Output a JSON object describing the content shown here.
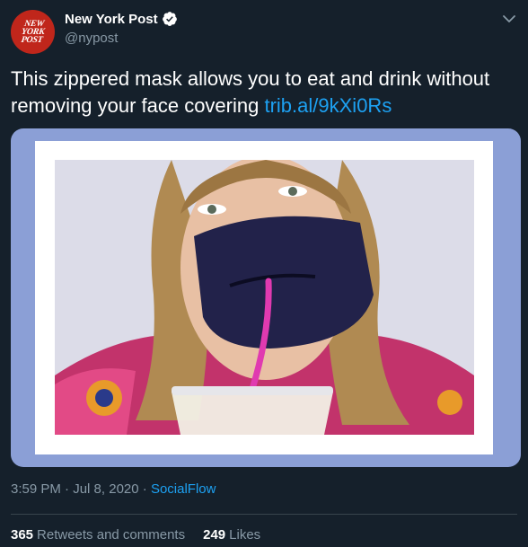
{
  "author": {
    "display_name": "New York Post",
    "handle": "@nypost",
    "avatar_lines": [
      "NEW",
      "YORK",
      "POST"
    ],
    "verified": true
  },
  "tweet": {
    "text": "This zippered mask allows you to eat and drink without removing your face covering",
    "link": "trib.al/9kXi0Rs"
  },
  "meta": {
    "time": "3:59 PM",
    "separator1": " · ",
    "date": "Jul 8, 2020",
    "separator2": " · ",
    "source": "SocialFlow"
  },
  "stats": {
    "retweets_count": "365",
    "retweets_label": "Retweets and comments",
    "likes_count": "249",
    "likes_label": "Likes"
  },
  "colors": {
    "background": "#15202b",
    "link": "#1da1f2",
    "muted": "#8899a6",
    "media_border": "#8b9fd6",
    "avatar": "#c0261b"
  },
  "icons": [
    "verified-badge-icon",
    "chevron-down-icon"
  ]
}
